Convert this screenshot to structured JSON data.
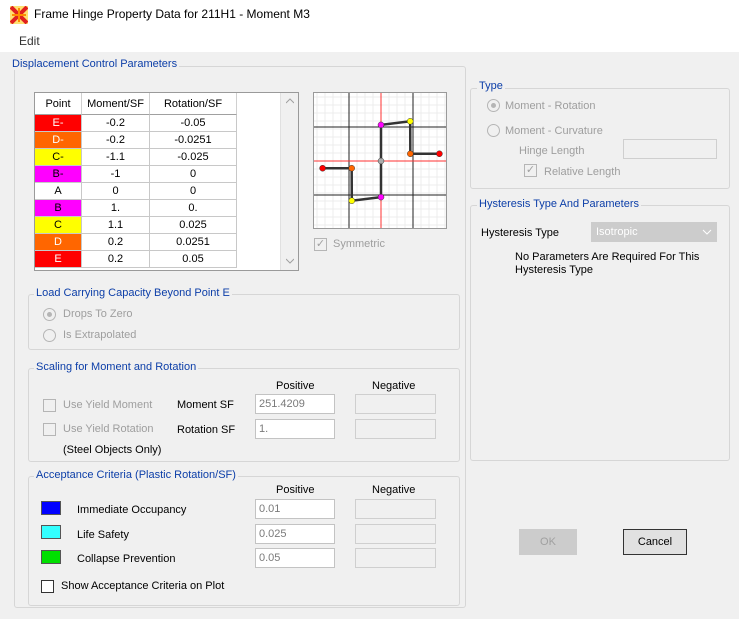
{
  "window": {
    "title": "Frame Hinge Property Data for 211H1 - Moment M3"
  },
  "menu": {
    "edit": "Edit"
  },
  "displacement": {
    "section_label": "Displacement Control Parameters",
    "columns": [
      "Point",
      "Moment/SF",
      "Rotation/SF"
    ],
    "rows": [
      {
        "point": "E-",
        "moment": "-0.2",
        "rotation": "-0.05",
        "color": "#ff0000"
      },
      {
        "point": "D-",
        "moment": "-0.2",
        "rotation": "-0.0251",
        "color": "#ff6600"
      },
      {
        "point": "C-",
        "moment": "-1.1",
        "rotation": "-0.025",
        "color": "#ffff00"
      },
      {
        "point": "B-",
        "moment": "-1",
        "rotation": "0",
        "color": "#ff00ff"
      },
      {
        "point": "A",
        "moment": "0",
        "rotation": "0",
        "color": "#ffffff"
      },
      {
        "point": "B",
        "moment": "1.",
        "rotation": "0.",
        "color": "#ff00ff"
      },
      {
        "point": "C",
        "moment": "1.1",
        "rotation": "0.025",
        "color": "#ffff00"
      },
      {
        "point": "D",
        "moment": "0.2",
        "rotation": "0.0251",
        "color": "#ff6600"
      },
      {
        "point": "E",
        "moment": "0.2",
        "rotation": "0.05",
        "color": "#ff0000"
      }
    ],
    "symmetric_label": "Symmetric"
  },
  "load_capacity": {
    "section_label": "Load Carrying Capacity Beyond Point E",
    "drops": "Drops To Zero",
    "extrapolated": "Is Extrapolated"
  },
  "scaling": {
    "section_label": "Scaling for Moment and Rotation",
    "positive": "Positive",
    "negative": "Negative",
    "use_yield_moment": "Use Yield Moment",
    "moment_sf_label": "Moment SF",
    "moment_sf_value": "251.4209",
    "use_yield_rotation": "Use Yield Rotation",
    "rotation_sf_label": "Rotation SF",
    "rotation_sf_value": "1.",
    "steel_note": "(Steel Objects Only)"
  },
  "acceptance": {
    "section_label": "Acceptance Criteria (Plastic Rotation/SF)",
    "positive": "Positive",
    "negative": "Negative",
    "items": [
      {
        "label": "Immediate Occupancy",
        "value": "0.01",
        "color": "#0000ff"
      },
      {
        "label": "Life Safety",
        "value": "0.025",
        "color": "#33ffff"
      },
      {
        "label": "Collapse Prevention",
        "value": "0.05",
        "color": "#00e000"
      }
    ],
    "show_on_plot": "Show Acceptance Criteria on Plot"
  },
  "type": {
    "section_label": "Type",
    "moment_rotation": "Moment - Rotation",
    "moment_curvature": "Moment - Curvature",
    "hinge_length": "Hinge Length",
    "relative_length": "Relative Length"
  },
  "hysteresis": {
    "section_label": "Hysteresis Type And Parameters",
    "type_label": "Hysteresis Type",
    "type_value": "Isotropic",
    "note": "No Parameters Are Required For This Hysteresis Type"
  },
  "buttons": {
    "ok": "OK",
    "cancel": "Cancel"
  }
}
